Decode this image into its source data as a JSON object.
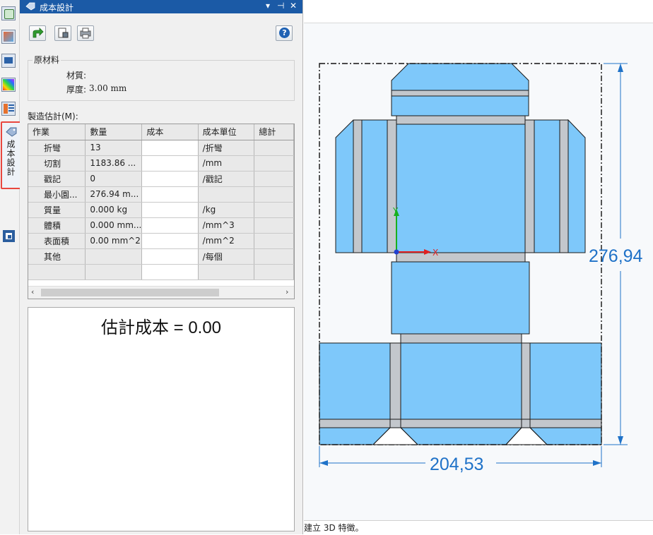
{
  "panel": {
    "title": "成本設計",
    "title_controls": [
      "▾",
      "⊣",
      "✕"
    ],
    "help_label": "?",
    "material_group": {
      "title": "原材料",
      "material_label": "材質:",
      "thickness_label": "厚度:",
      "thickness_value": "3.00 mm"
    },
    "estimate_label": "製造估計(M):",
    "table": {
      "headers": [
        "作業",
        "數量",
        "成本",
        "成本單位",
        "總計"
      ],
      "rows": [
        [
          "折彎",
          "13",
          "",
          "/折彎",
          ""
        ],
        [
          "切割",
          "1183.86 ...",
          "",
          "/mm",
          ""
        ],
        [
          "戳記",
          "0",
          "",
          "/戳記",
          ""
        ],
        [
          "最小園...",
          "276.94 m...",
          "",
          "",
          ""
        ],
        [
          "質量",
          "0.000 kg",
          "",
          "/kg",
          ""
        ],
        [
          "體積",
          "0.000 mm...",
          "",
          "/mm^3",
          ""
        ],
        [
          "表面積",
          "0.00 mm^2",
          "",
          "/mm^2",
          ""
        ],
        [
          "其他",
          "",
          "",
          "/每個",
          ""
        ],
        [
          "",
          "",
          "",
          "",
          ""
        ]
      ]
    },
    "estimated_cost": "估計成本 = 0.00"
  },
  "sidebar": {
    "active_tab_label": "成本設計",
    "icons": [
      "feature-manager-icon",
      "property-manager-icon",
      "display-manager-icon",
      "appearance-icon",
      "custom-properties-icon",
      "cost-design-icon",
      "dimxpert-icon"
    ]
  },
  "viewport": {
    "dimension_height": "276,94",
    "dimension_width": "204,53",
    "axis_x": "X",
    "axis_y": "Y"
  },
  "status": {
    "text": "建立 3D 特徵。"
  },
  "colors": {
    "title_bar": "#1b5aa6",
    "flat_pattern_fill": "#7ec8fa",
    "bend_strip": "#c3c7cc",
    "dimension": "#1f72c8",
    "highlight": "#e8473f"
  }
}
